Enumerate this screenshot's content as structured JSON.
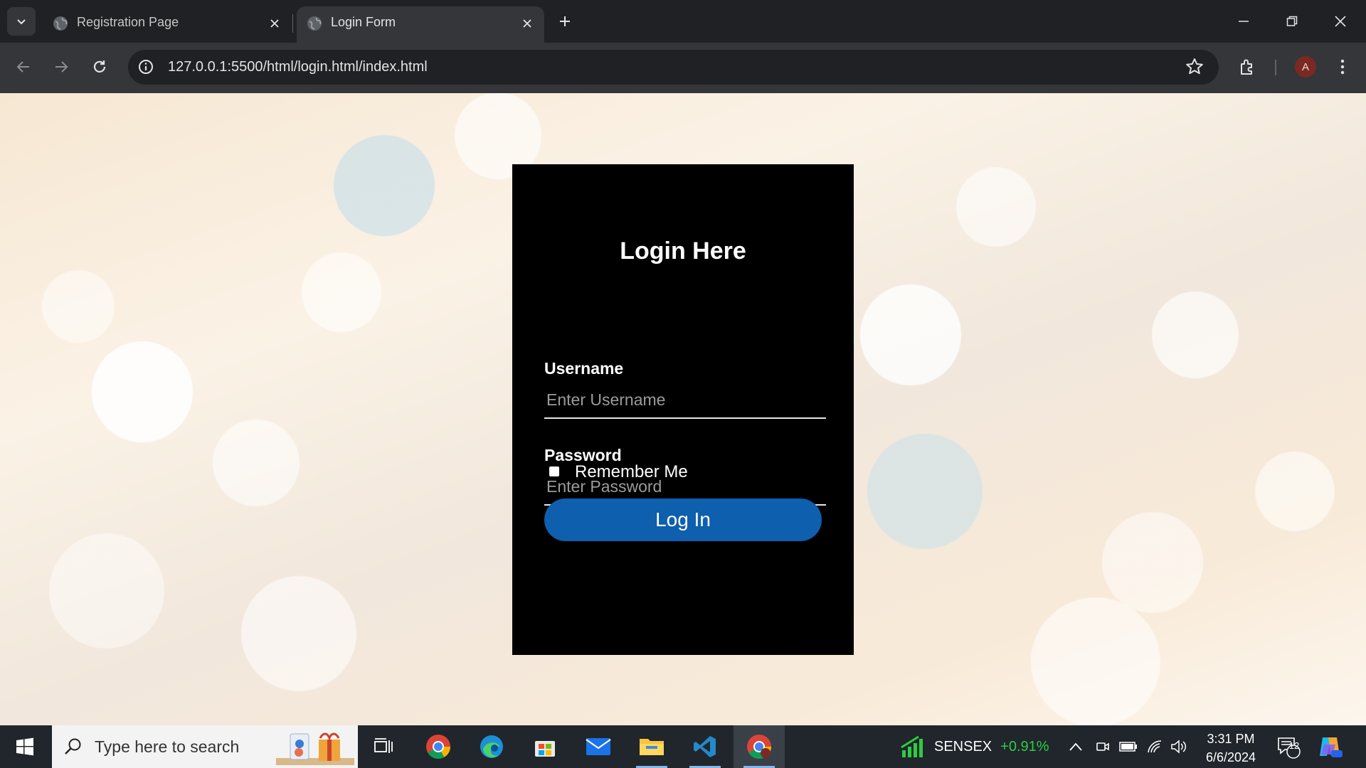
{
  "browser": {
    "tabs": [
      {
        "title": "Registration Page",
        "active": false
      },
      {
        "title": "Login Form",
        "active": true
      }
    ],
    "address_host": "127.0.0.1",
    "address_path": ":5500/html/login.html/index.html",
    "profile_initial": "A"
  },
  "login": {
    "title": "Login Here",
    "username_label": "Username",
    "username_placeholder": "Enter Username",
    "password_label": "Password",
    "password_placeholder": "Enter Password",
    "remember_label": "Remember Me",
    "remember_checked": false,
    "button_label": "Log In"
  },
  "taskbar": {
    "search_placeholder": "Type here to search",
    "stock_name": "SENSEX",
    "stock_change": "+0.91%",
    "time": "3:31 PM",
    "date": "6/6/2024",
    "notification_count": "12"
  },
  "colors": {
    "login_button": "#0e5fae",
    "stock_positive": "#2ecc40",
    "card": "#000000"
  },
  "icons": {
    "tab_favicon": "globe-icon",
    "address_info": "info-icon",
    "bookmark": "star-icon",
    "extensions": "puzzle-icon",
    "menu": "kebab-icon"
  }
}
